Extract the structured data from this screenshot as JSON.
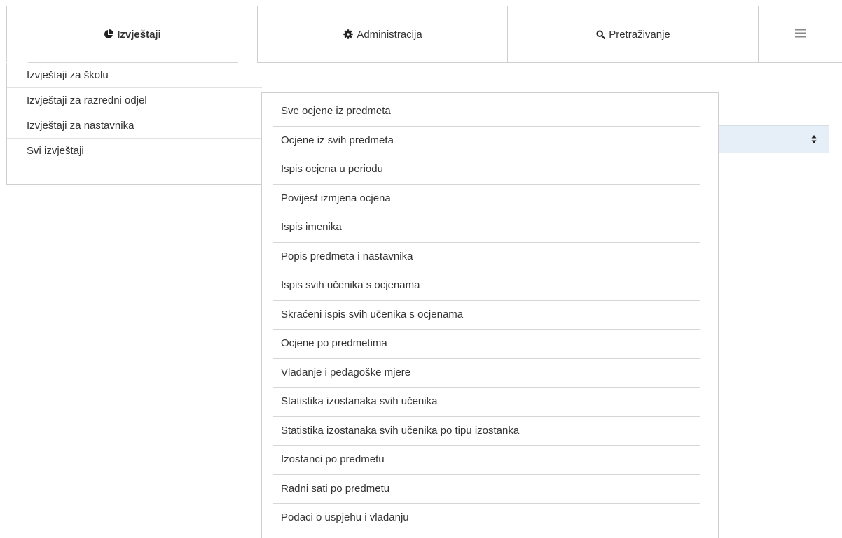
{
  "nav": {
    "tabs": [
      {
        "label": "Izvještaji",
        "icon": "pie-chart-icon"
      },
      {
        "label": "Administracija",
        "icon": "gear-icon"
      },
      {
        "label": "Pretraživanje",
        "icon": "search-icon"
      }
    ],
    "menu_icon": "hamburger-menu-icon"
  },
  "submenu": {
    "items": [
      "Izvještaji za školu",
      "Izvještaji za razredni odjel",
      "Izvještaji za nastavnika",
      "Svi izvještaji"
    ]
  },
  "flyout": {
    "items": [
      "Sve ocjene iz predmeta",
      "Ocjene iz svih predmeta",
      "Ispis ocjena u periodu",
      "Povijest izmjena ocjena",
      "Ispis imenika",
      "Popis predmeta i nastavnika",
      "Ispis svih učenika s ocjenama",
      "Skraćeni ispis svih učenika s ocjenama",
      "Ocjene po predmetima",
      "Vladanje i pedagoške mjere",
      "Statistika izostanaka svih učenika",
      "Statistika izostanaka svih učenika po tipu izostanka",
      "Izostanci po predmetu",
      "Radni sati po predmetu",
      "Podaci o uspjehu i vladanju"
    ],
    "highlighted_index": 4
  },
  "colors": {
    "highlight_border": "#e02020",
    "highlight_fill": "#fde0e0",
    "select_bg": "#e6eff7"
  }
}
